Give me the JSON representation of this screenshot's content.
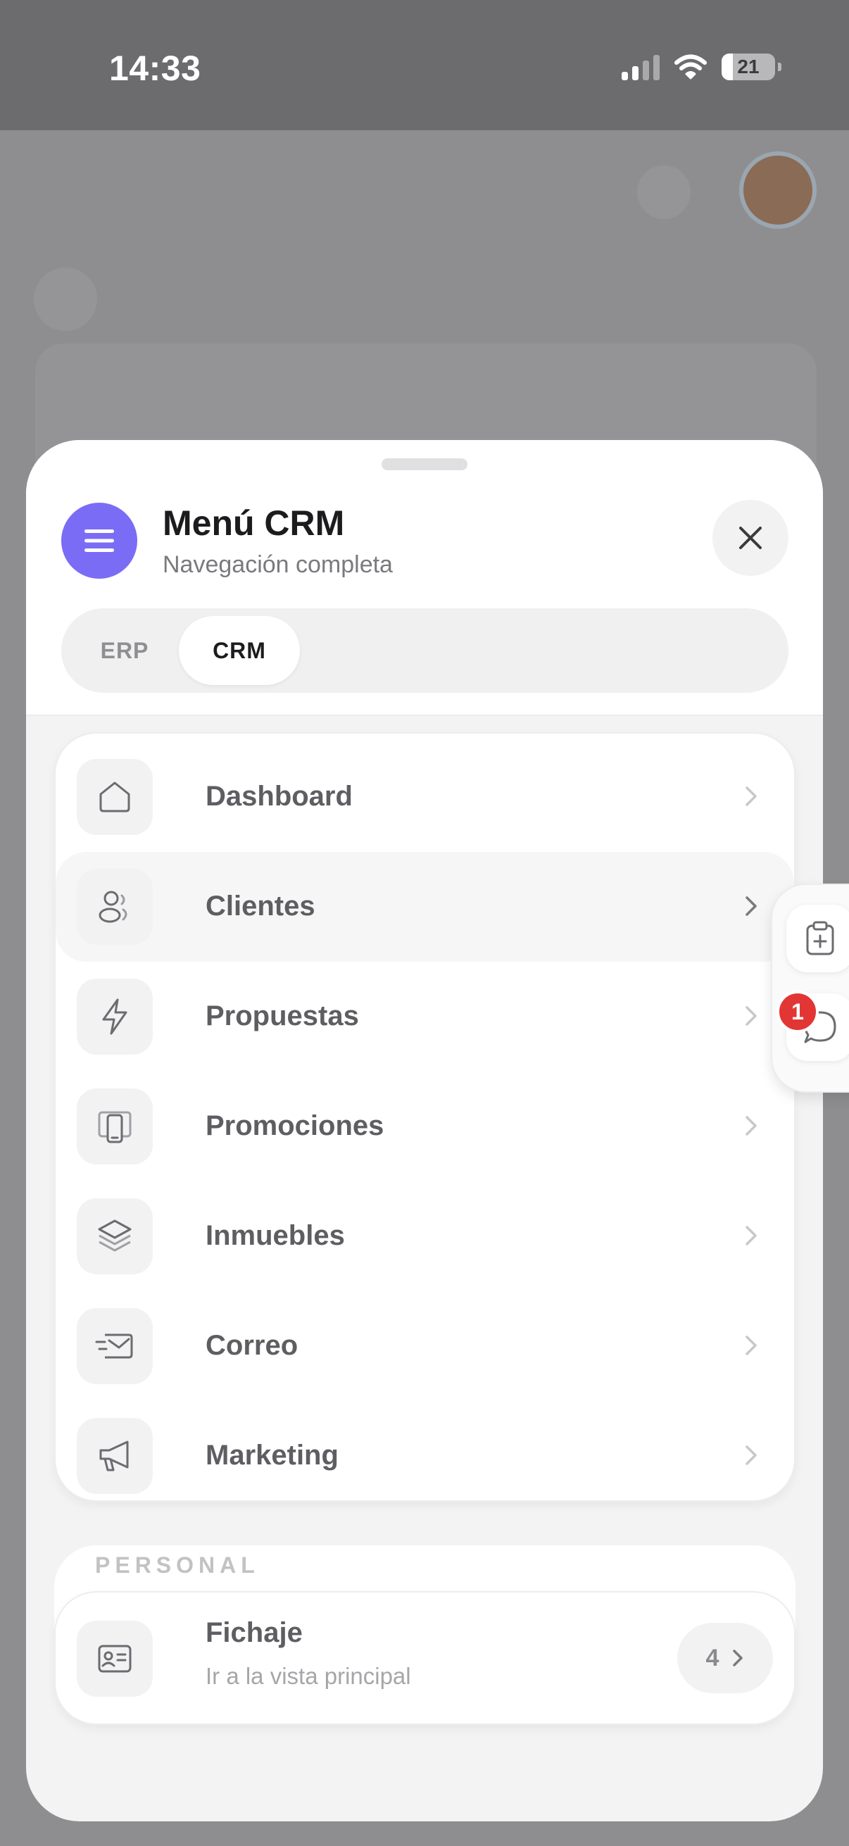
{
  "status_bar": {
    "time": "14:33",
    "battery": "21"
  },
  "sheet": {
    "title": "Menú CRM",
    "subtitle": "Navegación completa",
    "tabs": [
      {
        "label": "ERP",
        "active": false
      },
      {
        "label": "CRM",
        "active": true
      }
    ],
    "menu_items": [
      {
        "label": "Dashboard",
        "icon": "home-icon"
      },
      {
        "label": "Clientes",
        "icon": "users-icon"
      },
      {
        "label": "Propuestas",
        "icon": "lightning-icon"
      },
      {
        "label": "Promociones",
        "icon": "phone-cards-icon"
      },
      {
        "label": "Inmuebles",
        "icon": "layers-icon"
      },
      {
        "label": "Correo",
        "icon": "mail-fast-icon"
      },
      {
        "label": "Marketing",
        "icon": "megaphone-icon"
      }
    ],
    "personal": {
      "section_title": "PERSONAL",
      "item_label": "Fichaje",
      "item_subtitle": "Ir a la vista principal",
      "count": "4"
    }
  },
  "floating_actions": {
    "notification_count": "1"
  },
  "colors": {
    "accent": "#7b6cf6",
    "notification": "#e23634"
  }
}
